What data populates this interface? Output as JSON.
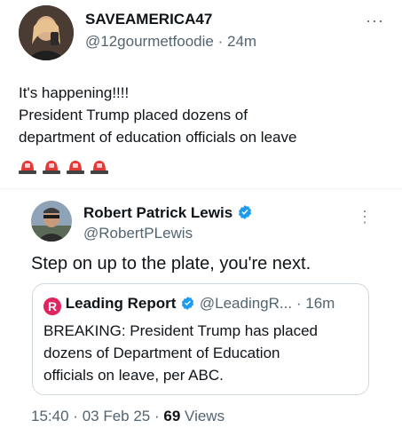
{
  "tweet": {
    "display_name": "SAVEAMERICA47",
    "handle": "@12gourmetfoodie",
    "separator": "·",
    "time_ago": "24m",
    "more_menu": "···",
    "body_line1": "It's happening!!!!",
    "body_line2": "President Trump placed dozens of",
    "body_line3": "department of education officials on leave",
    "emoji_count": 4,
    "emoji_icon": "police-siren-icon"
  },
  "reply": {
    "display_name": "Robert Patrick Lewis",
    "handle": "@RobertPLewis",
    "more_menu": "⋮",
    "body": "Step on up to the plate, you're next."
  },
  "quote": {
    "display_name": "Leading Report",
    "handle": "@LeadingR...",
    "separator": "·",
    "time_ago": "16m",
    "logo_letter": "R",
    "body_line1": "BREAKING: President Trump has placed",
    "body_line2": "dozens of Department of Education",
    "body_line3": "officials on leave, per ABC."
  },
  "meta": {
    "time": "15:40",
    "separator1": "·",
    "date": "03 Feb 25",
    "separator2": "·",
    "views_count": "69",
    "views_label": "Views"
  },
  "colors": {
    "verified_blue": "#1d9bf0",
    "logo_red": "#e0245e",
    "siren_red": "#e53935",
    "muted": "#536471"
  }
}
